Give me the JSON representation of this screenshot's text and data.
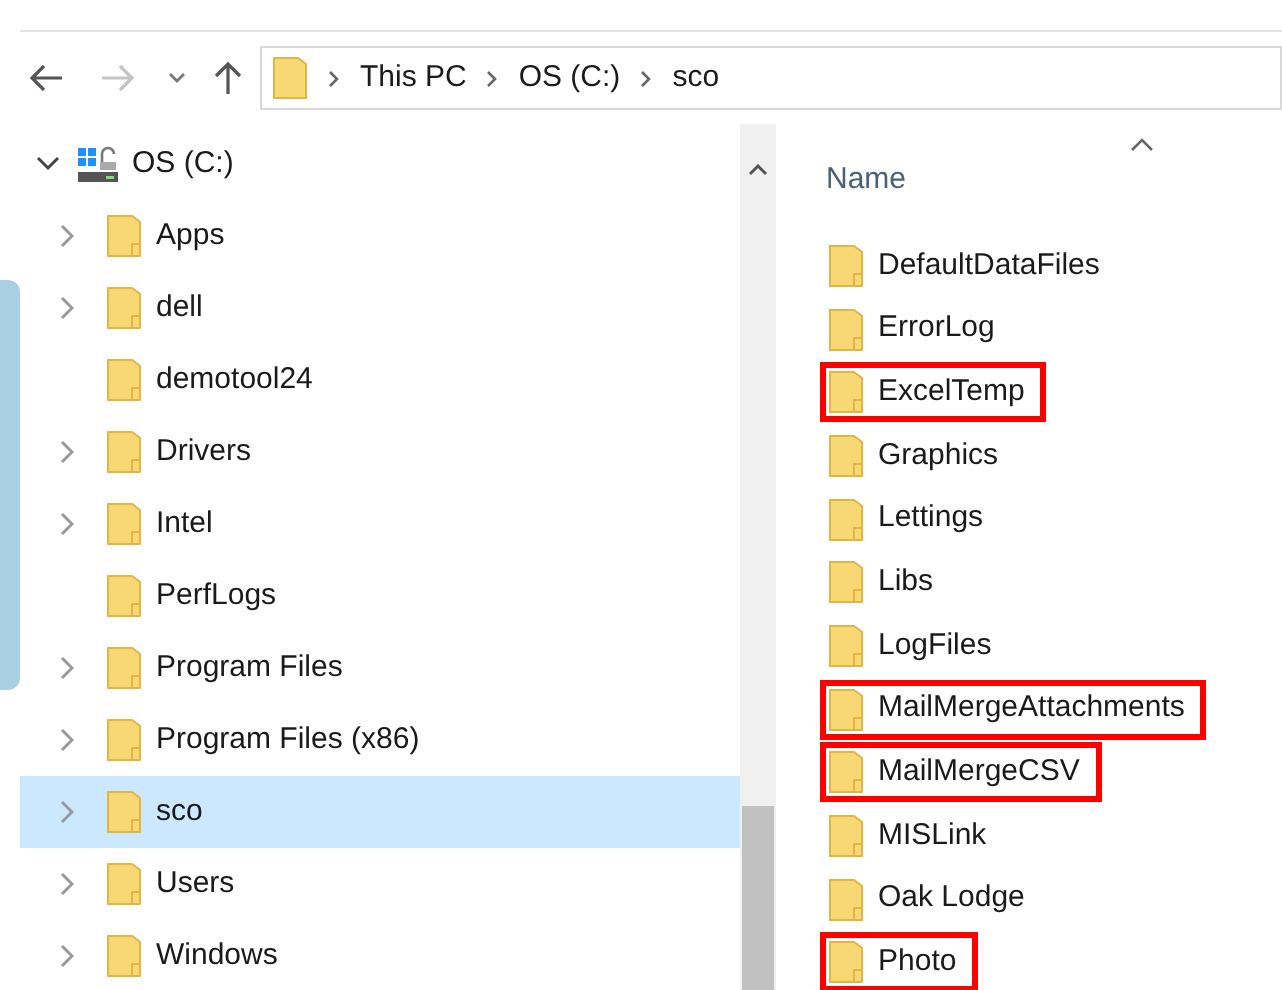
{
  "address_bar": {
    "segments": [
      "This PC",
      "OS (C:)",
      "sco"
    ]
  },
  "navigation_pane": {
    "root": {
      "label": "OS (C:)",
      "expanded": true,
      "children": [
        {
          "label": "Apps",
          "has_children": true,
          "selected": false
        },
        {
          "label": "dell",
          "has_children": true,
          "selected": false
        },
        {
          "label": "demotool24",
          "has_children": false,
          "selected": false
        },
        {
          "label": "Drivers",
          "has_children": true,
          "selected": false
        },
        {
          "label": "Intel",
          "has_children": true,
          "selected": false
        },
        {
          "label": "PerfLogs",
          "has_children": false,
          "selected": false
        },
        {
          "label": "Program Files",
          "has_children": true,
          "selected": false
        },
        {
          "label": "Program Files (x86)",
          "has_children": true,
          "selected": false
        },
        {
          "label": "sco",
          "has_children": true,
          "selected": true
        },
        {
          "label": "Users",
          "has_children": true,
          "selected": false
        },
        {
          "label": "Windows",
          "has_children": true,
          "selected": false
        }
      ]
    }
  },
  "file_list": {
    "column_header": "Name",
    "items": [
      {
        "name": "DefaultDataFiles",
        "highlighted": false
      },
      {
        "name": "ErrorLog",
        "highlighted": false
      },
      {
        "name": "ExcelTemp",
        "highlighted": true
      },
      {
        "name": "Graphics",
        "highlighted": false
      },
      {
        "name": "Lettings",
        "highlighted": false
      },
      {
        "name": "Libs",
        "highlighted": false
      },
      {
        "name": "LogFiles",
        "highlighted": false
      },
      {
        "name": "MailMergeAttachments",
        "highlighted": true
      },
      {
        "name": "MailMergeCSV",
        "highlighted": true
      },
      {
        "name": "MISLink",
        "highlighted": false
      },
      {
        "name": "Oak Lodge",
        "highlighted": false
      },
      {
        "name": "Photo",
        "highlighted": true
      }
    ]
  }
}
